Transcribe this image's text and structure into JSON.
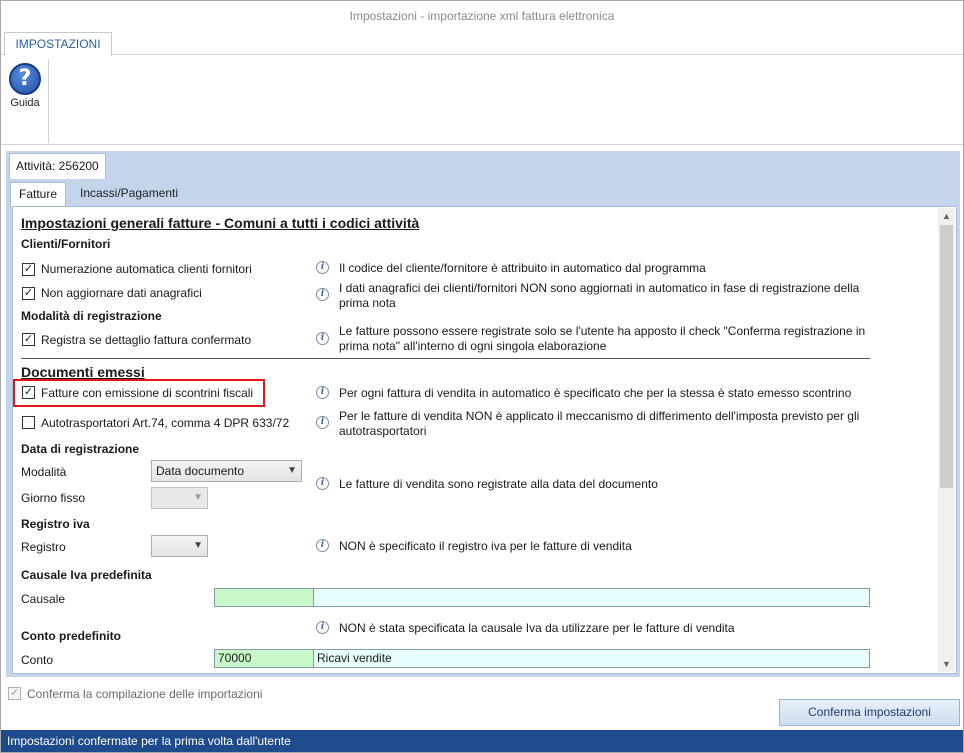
{
  "window": {
    "title": "Impostazioni - importazione xml fattura elettronica"
  },
  "ribbon": {
    "tab": "IMPOSTAZIONI",
    "buttons": [
      {
        "label": "Guida",
        "icon": "help-icon"
      }
    ]
  },
  "activity_tab": "Attività: 256200",
  "subtabs": [
    "Fatture",
    "Incassi/Pagamenti"
  ],
  "general": {
    "title": "Impostazioni generali fatture - Comuni a tutti i codici attività",
    "clients_heading": "Clienti/Fornitori",
    "numbering": {
      "label": "Numerazione automatica clienti fornitori",
      "checked": true,
      "info": "Il codice del cliente/fornitore è attribuito in automatico dal programma"
    },
    "no_update": {
      "label": "Non aggiornare dati anagrafici",
      "checked": true,
      "info": "I dati anagrafici dei clienti/fornitori NON sono aggiornati in automatico in fase di registrazione della prima nota"
    },
    "registration_heading": "Modalità di registrazione",
    "register_if": {
      "label": "Registra se dettaglio fattura confermato",
      "checked": true,
      "info": "Le fatture possono essere registrate solo se l'utente ha apposto il check \"Conferma registrazione in prima nota\" all'interno di ogni singola elaborazione"
    }
  },
  "issued": {
    "title": "Documenti emessi",
    "receipts": {
      "label": "Fatture con emissione di scontrini fiscali",
      "checked": true,
      "info": "Per ogni fattura di vendita in automatico è specificato che per la stessa è stato emesso scontrino"
    },
    "auto": {
      "label": "Autotrasportatori Art.74, comma 4 DPR 633/72",
      "checked": false,
      "info": "Per le fatture di vendita NON è applicato il meccanismo di differimento dell'imposta previsto per gli autotrasportatori"
    },
    "date_heading": "Data di registrazione",
    "modalita_label": "Modalità",
    "modalita_value": "Data documento",
    "giorno_label": "Giorno fisso",
    "giorno_value": "",
    "date_info": "Le fatture di vendita sono registrate alla data del documento",
    "iva_heading": "Registro iva",
    "registro_label": "Registro",
    "registro_value": "",
    "registro_info": "NON è specificato il registro iva per le fatture di vendita",
    "causale_heading": "Causale Iva predefinita",
    "causale_label": "Causale",
    "causale_code": "",
    "causale_desc": "",
    "causale_info": "NON è stata specificata la causale Iva da utilizzare per le fatture di vendita",
    "conto_heading": "Conto predefinito",
    "conto_label": "Conto",
    "conto_code": "70000",
    "conto_desc": "Ricavi vendite"
  },
  "footer": {
    "confirm_label": "Conferma la compilazione delle importazioni",
    "confirm_checked": true,
    "button": "Conferma impostazioni"
  },
  "status": "Impostazioni confermate per la prima volta dall'utente"
}
